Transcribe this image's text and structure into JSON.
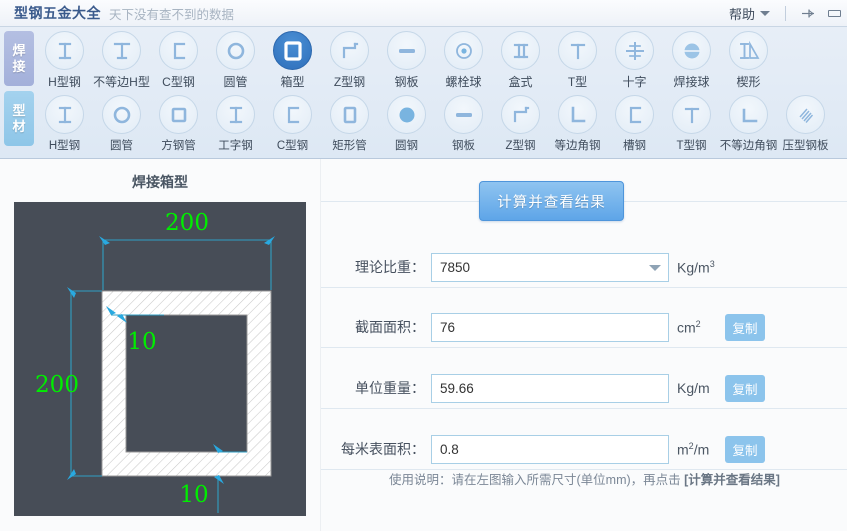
{
  "titlebar": {
    "app_title": "型钢五金大全",
    "slogan": "天下没有查不到的数据",
    "help_label": "帮助",
    "pin_icon": "pin-icon",
    "minimize_icon": "minimize-icon"
  },
  "toolbar": {
    "tabs": [
      {
        "label": "焊接",
        "selected": true
      },
      {
        "label": "型材",
        "selected": false
      }
    ],
    "row1": [
      {
        "label": "H型钢",
        "icon": "h-beam-icon",
        "selected": false
      },
      {
        "label": "不等边H型",
        "icon": "unequal-h-beam-icon",
        "selected": false
      },
      {
        "label": "C型钢",
        "icon": "c-channel-icon",
        "selected": false
      },
      {
        "label": "圆管",
        "icon": "round-pipe-icon",
        "selected": false
      },
      {
        "label": "箱型",
        "icon": "box-section-icon",
        "selected": true
      },
      {
        "label": "Z型钢",
        "icon": "z-beam-icon",
        "selected": false
      },
      {
        "label": "钢板",
        "icon": "steel-plate-icon",
        "selected": false
      },
      {
        "label": "螺栓球",
        "icon": "bolt-ball-icon",
        "selected": false
      },
      {
        "label": "盒式",
        "icon": "box-type-icon",
        "selected": false
      },
      {
        "label": "T型",
        "icon": "t-beam-icon",
        "selected": false
      },
      {
        "label": "十字",
        "icon": "cross-beam-icon",
        "selected": false
      },
      {
        "label": "焊接球",
        "icon": "welded-ball-icon",
        "selected": false
      },
      {
        "label": "楔形",
        "icon": "wedge-icon",
        "selected": false
      }
    ],
    "row2": [
      {
        "label": "H型钢",
        "icon": "h-beam-icon",
        "selected": false
      },
      {
        "label": "圆管",
        "icon": "round-pipe-icon",
        "selected": false
      },
      {
        "label": "方钢管",
        "icon": "square-pipe-icon",
        "selected": false
      },
      {
        "label": "工字钢",
        "icon": "i-beam-icon",
        "selected": false
      },
      {
        "label": "C型钢",
        "icon": "c-channel-icon",
        "selected": false
      },
      {
        "label": "矩形管",
        "icon": "rect-pipe-icon",
        "selected": false
      },
      {
        "label": "圆钢",
        "icon": "round-bar-icon",
        "selected": false
      },
      {
        "label": "钢板",
        "icon": "steel-plate-icon",
        "selected": false
      },
      {
        "label": "Z型钢",
        "icon": "z-beam-icon",
        "selected": false
      },
      {
        "label": "等边角钢",
        "icon": "equal-angle-icon",
        "selected": false
      },
      {
        "label": "槽钢",
        "icon": "channel-steel-icon",
        "selected": false
      },
      {
        "label": "T型钢",
        "icon": "t-steel-icon",
        "selected": false
      },
      {
        "label": "不等边角钢",
        "icon": "unequal-angle-icon",
        "selected": false
      },
      {
        "label": "压型钢板",
        "icon": "corrugated-plate-icon",
        "selected": false
      }
    ]
  },
  "diagram": {
    "title": "焊接箱型",
    "bg_color": "#474d57",
    "dim_color": "#00ee00",
    "line_color": "#2f9fc4",
    "dim_width_top": "200",
    "dim_height_left": "200",
    "dim_thickness_top": "10",
    "dim_thickness_bottom": "10"
  },
  "form": {
    "calc_button": "计算并查看结果",
    "fields": [
      {
        "label": "理论比重：",
        "value": "7850",
        "unit_text": "Kg/m",
        "unit_sup": "3",
        "type": "select",
        "copy": null
      },
      {
        "label": "截面面积：",
        "value": "76",
        "unit_text": "cm",
        "unit_sup": "2",
        "type": "input",
        "copy": "复制"
      },
      {
        "label": "单位重量：",
        "value": "59.66",
        "unit_text": "Kg/m",
        "unit_sup": "",
        "type": "input",
        "copy": "复制"
      },
      {
        "label": "每米表面积：",
        "value": "0.8",
        "unit_text": "m",
        "unit_sup": "2",
        "unit_tail": "/m",
        "type": "input",
        "copy": "复制"
      }
    ],
    "hint_prefix": "使用说明：请在左图输入所需尺寸(单位mm)，再点击 ",
    "hint_strong": "[计算并查看结果]"
  },
  "colors": {
    "accent": "#5ea5e8",
    "tab_selected": "#a3b0da",
    "tab_alt": "#8ec6e8",
    "icon_active": "#2e6fbb",
    "input_border": "#a8cfe6"
  }
}
